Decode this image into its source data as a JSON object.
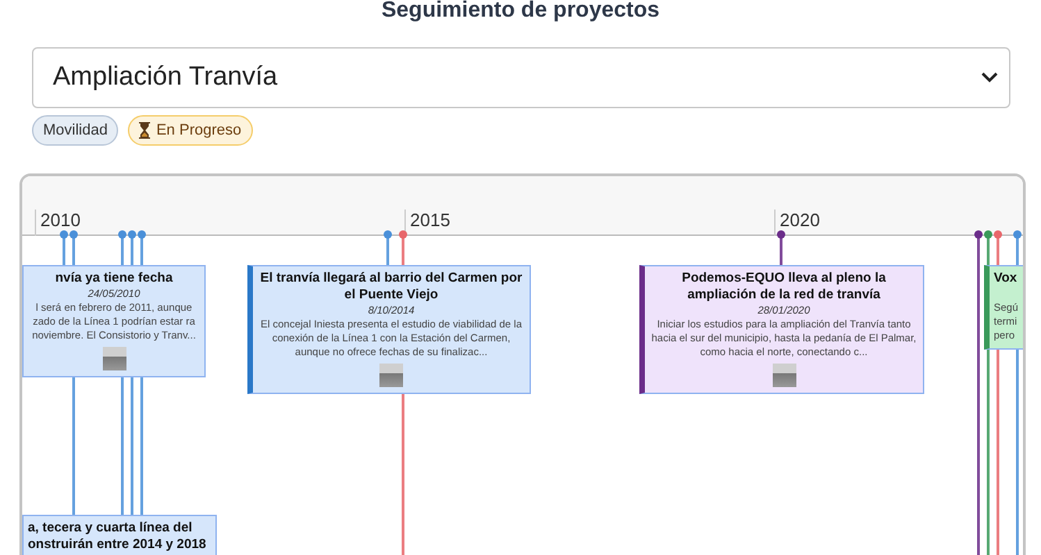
{
  "title": "Seguimiento de proyectos",
  "project_select": {
    "value": "Ampliación Tranvía"
  },
  "tags": [
    {
      "label": "Movilidad",
      "kind": "category"
    },
    {
      "label": "En Progreso",
      "kind": "status"
    }
  ],
  "timeline": {
    "years": [
      "2010",
      "2015",
      "2020"
    ],
    "markers": [
      {
        "color": "#4a90d9"
      },
      {
        "color": "#4a90d9"
      },
      {
        "color": "#4a90d9"
      },
      {
        "color": "#4a90d9"
      },
      {
        "color": "#4a90d9"
      },
      {
        "color": "#4a90d9"
      },
      {
        "color": "#e8676b"
      },
      {
        "color": "#6b2d8a"
      },
      {
        "color": "#6b2d8a"
      },
      {
        "color": "#3a9a5a"
      },
      {
        "color": "#e8676b"
      },
      {
        "color": "#4a90d9"
      }
    ],
    "cards": [
      {
        "title": "nvía ya tiene fecha",
        "date": "24/05/2010",
        "body": "l será en febrero de 2011, aunque zado de la Línea 1 podrían estar ra noviembre. El Consistorio y Tranv...",
        "color": "#8fb3f0",
        "image": true
      },
      {
        "title": "El tranvía llegará al barrio del Carmen por el Puente Viejo",
        "date": "8/10/2014",
        "body": "El concejal Iniesta presenta el estudio de viabilidad de la conexión de la Línea 1 con la Estación del Carmen, aunque no ofrece fechas de su finalizac...",
        "color": "#2a78c8",
        "image": true
      },
      {
        "title": "Podemos-EQUO lleva al pleno la ampliación de la red de tranvía",
        "date": "28/01/2020",
        "body": "Iniciar los estudios para la ampliación del Tranvía tanto hacia el sur del municipio, hasta la pedanía de El Palmar, como hacia el norte, conectando c...",
        "color": "#6b2d8a",
        "image": true
      },
      {
        "title": "Vox",
        "body": "Segú termi pero",
        "color": "#3a9a5a"
      },
      {
        "title": "a, tecera y cuarta línea del onstruirán entre 2014 y 2018",
        "color": "#8fb3f0"
      }
    ]
  }
}
